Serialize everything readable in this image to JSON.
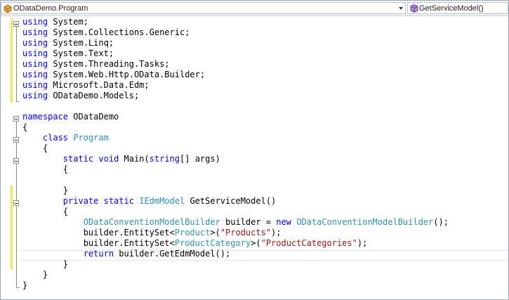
{
  "navigation": {
    "type_dropdown": {
      "label": "ODataDemo.Program",
      "icon": "class-icon"
    },
    "member_dropdown": {
      "label": "GetServiceModel()",
      "icon": "method-icon"
    }
  },
  "colors": {
    "keyword": "#0000ff",
    "type": "#2b91af",
    "string": "#a31515",
    "change_marker": "#f5e94d"
  },
  "code_lines": [
    [
      [
        "kw",
        "using"
      ],
      [
        "pl",
        " System;"
      ]
    ],
    [
      [
        "kw",
        "using"
      ],
      [
        "pl",
        " System.Collections.Generic;"
      ]
    ],
    [
      [
        "kw",
        "using"
      ],
      [
        "pl",
        " System.Linq;"
      ]
    ],
    [
      [
        "kw",
        "using"
      ],
      [
        "pl",
        " System.Text;"
      ]
    ],
    [
      [
        "kw",
        "using"
      ],
      [
        "pl",
        " System.Threading.Tasks;"
      ]
    ],
    [
      [
        "kw",
        "using"
      ],
      [
        "pl",
        " System.Web.Http.OData.Builder;"
      ]
    ],
    [
      [
        "kw",
        "using"
      ],
      [
        "pl",
        " Microsoft.Data.Edm;"
      ]
    ],
    [
      [
        "kw",
        "using"
      ],
      [
        "pl",
        " ODataDemo.Models;"
      ]
    ],
    [],
    [
      [
        "kw",
        "namespace"
      ],
      [
        "pl",
        " ODataDemo"
      ]
    ],
    [
      [
        "pl",
        "{"
      ]
    ],
    [
      [
        "pl",
        "    "
      ],
      [
        "kw",
        "class"
      ],
      [
        "pl",
        " "
      ],
      [
        "ty",
        "Program"
      ]
    ],
    [
      [
        "pl",
        "    {"
      ]
    ],
    [
      [
        "pl",
        "        "
      ],
      [
        "kw",
        "static"
      ],
      [
        "pl",
        " "
      ],
      [
        "kw",
        "void"
      ],
      [
        "pl",
        " Main("
      ],
      [
        "kw",
        "string"
      ],
      [
        "pl",
        "[] args)"
      ]
    ],
    [
      [
        "pl",
        "        {"
      ]
    ],
    [],
    [
      [
        "pl",
        "        }"
      ]
    ],
    [
      [
        "pl",
        "        "
      ],
      [
        "kw",
        "private"
      ],
      [
        "pl",
        " "
      ],
      [
        "kw",
        "static"
      ],
      [
        "pl",
        " "
      ],
      [
        "ty",
        "IEdmModel"
      ],
      [
        "pl",
        " GetServiceModel()"
      ]
    ],
    [
      [
        "pl",
        "        {"
      ]
    ],
    [
      [
        "pl",
        "            "
      ],
      [
        "ty",
        "ODataConventionModelBuilder"
      ],
      [
        "pl",
        " builder = "
      ],
      [
        "kw",
        "new"
      ],
      [
        "pl",
        " "
      ],
      [
        "ty",
        "ODataConventionModelBuilder"
      ],
      [
        "pl",
        "();"
      ]
    ],
    [
      [
        "pl",
        "            builder.EntitySet<"
      ],
      [
        "ty",
        "Product"
      ],
      [
        "pl",
        ">("
      ],
      [
        "str",
        "\"Products\""
      ],
      [
        "pl",
        ");"
      ]
    ],
    [
      [
        "pl",
        "            builder.EntitySet<"
      ],
      [
        "ty",
        "ProductCategory"
      ],
      [
        "pl",
        ">("
      ],
      [
        "str",
        "\"ProductCategories\""
      ],
      [
        "pl",
        ");"
      ]
    ],
    [
      [
        "pl",
        "            "
      ],
      [
        "kw",
        "return"
      ],
      [
        "pl",
        " builder.GetEdmModel();"
      ]
    ],
    [
      [
        "pl",
        "        }"
      ]
    ],
    [
      [
        "pl",
        "    }"
      ]
    ],
    [
      [
        "pl",
        "}"
      ]
    ]
  ]
}
